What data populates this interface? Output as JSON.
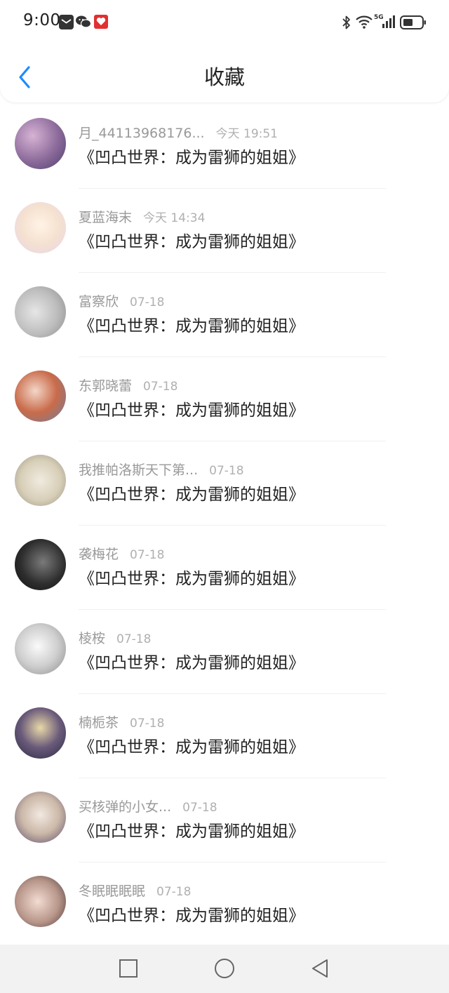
{
  "status_bar": {
    "time": "9:00",
    "left_icons": [
      "mail-icon",
      "wechat-icon",
      "app-notification-icon"
    ],
    "right_icons": [
      "bluetooth-icon",
      "wifi-icon",
      "5g-signal-icon",
      "battery-icon"
    ],
    "network_label": "5G"
  },
  "header": {
    "title": "收藏",
    "back_icon": "chevron-left-icon"
  },
  "colors": {
    "accent": "#1a8cff",
    "title": "#222222",
    "username": "#999999",
    "timestamp": "#b0b0b0"
  },
  "favorites": [
    {
      "user": "月_44113968176...",
      "time": "今天 19:51",
      "title": "《凹凸世界：成为雷狮的姐姐》"
    },
    {
      "user": "夏蓝海末",
      "time": "今天 14:34",
      "title": "《凹凸世界：成为雷狮的姐姐》"
    },
    {
      "user": "富察欣",
      "time": "07-18",
      "title": "《凹凸世界：成为雷狮的姐姐》"
    },
    {
      "user": "东郭晓蕾",
      "time": "07-18",
      "title": "《凹凸世界：成为雷狮的姐姐》"
    },
    {
      "user": "我推帕洛斯天下第...",
      "time": "07-18",
      "title": "《凹凸世界：成为雷狮的姐姐》"
    },
    {
      "user": "袭梅花",
      "time": "07-18",
      "title": "《凹凸世界：成为雷狮的姐姐》"
    },
    {
      "user": "棱桉",
      "time": "07-18",
      "title": "《凹凸世界：成为雷狮的姐姐》"
    },
    {
      "user": "楠栀茶",
      "time": "07-18",
      "title": "《凹凸世界：成为雷狮的姐姐》"
    },
    {
      "user": "买核弹的小女...",
      "time": "07-18",
      "title": "《凹凸世界：成为雷狮的姐姐》"
    },
    {
      "user": "冬眠眠眠眠",
      "time": "07-18",
      "title": "《凹凸世界：成为雷狮的姐姐》"
    }
  ],
  "bottom_nav": {
    "buttons": [
      "recent-apps-square-icon",
      "home-circle-icon",
      "back-triangle-icon"
    ]
  }
}
